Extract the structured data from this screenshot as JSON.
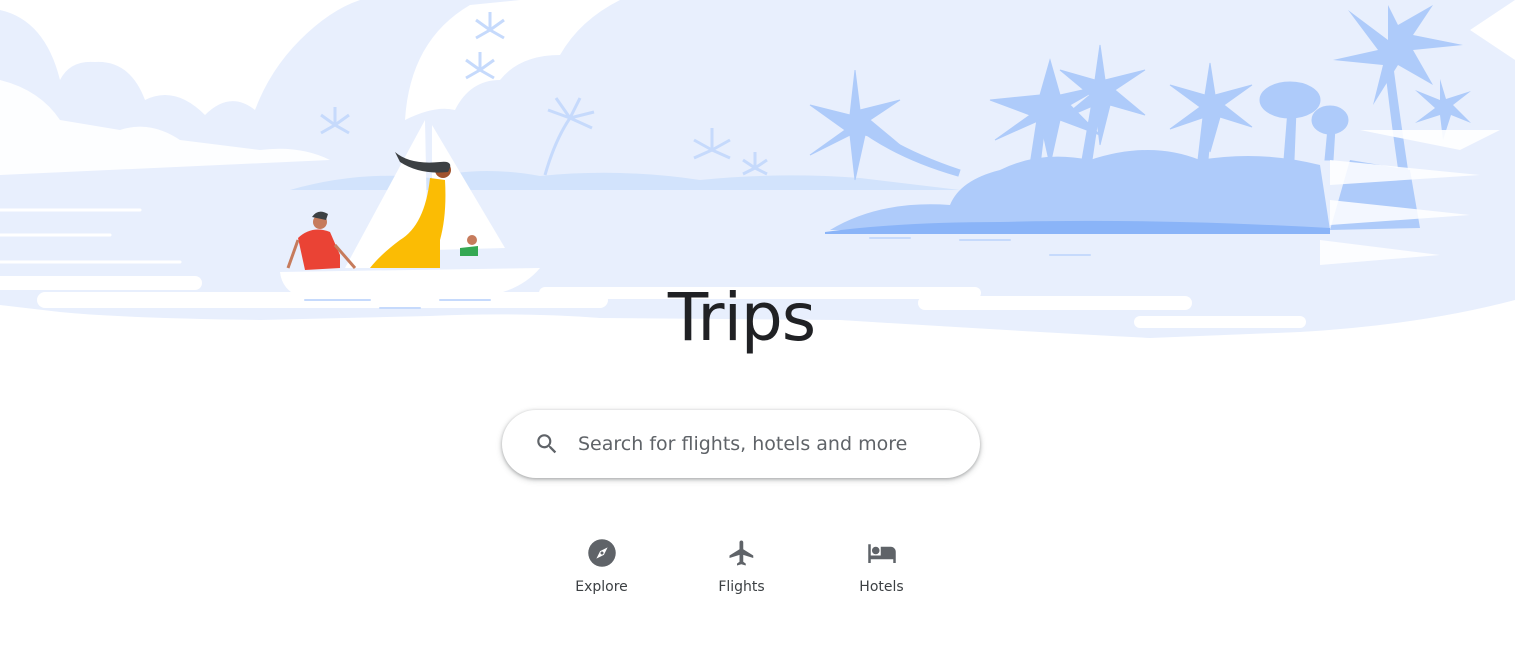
{
  "page": {
    "title": "Trips"
  },
  "search": {
    "placeholder": "Search for flights, hotels and more",
    "value": ""
  },
  "nav": {
    "items": [
      {
        "label": "Explore",
        "icon": "compass-icon"
      },
      {
        "label": "Flights",
        "icon": "airplane-icon"
      },
      {
        "label": "Hotels",
        "icon": "bed-icon"
      }
    ]
  },
  "colors": {
    "sky": "#e8effd",
    "island": "#aecbfa",
    "island_shore": "#8ab4f8",
    "title_text": "#202124",
    "icon": "#5f6368"
  }
}
